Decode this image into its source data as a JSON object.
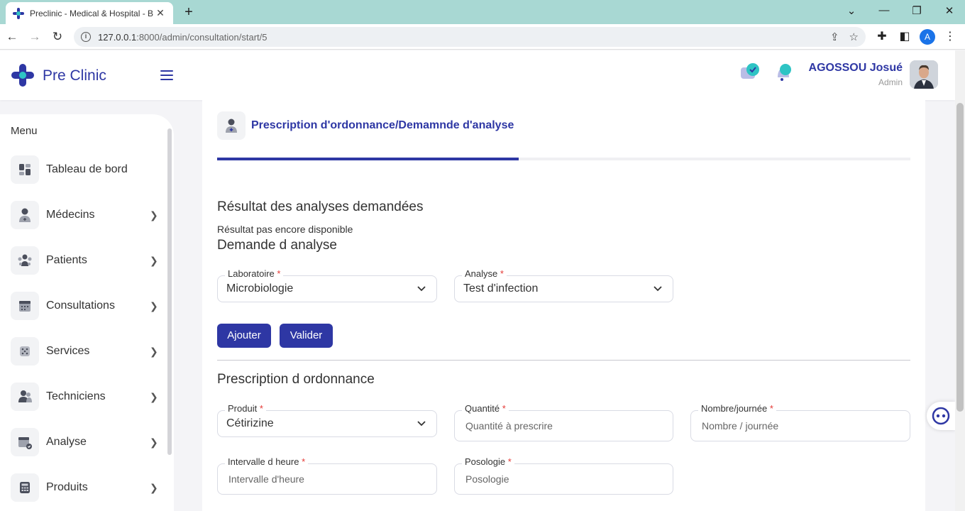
{
  "browser": {
    "tab_title": "Preclinic - Medical & Hospital - B",
    "url_host": "127.0.0.1",
    "url_path": ":8000/admin/consultation/start/5",
    "profile_initial": "A"
  },
  "header": {
    "brand": "Pre Clinic",
    "user_name": "AGOSSOU Josué",
    "user_role": "Admin"
  },
  "sidebar": {
    "menu_title": "Menu",
    "items": [
      {
        "label": "Tableau de bord",
        "icon": "dashboard-icon",
        "has_chevron": false
      },
      {
        "label": "Médecins",
        "icon": "doctor-icon",
        "has_chevron": true
      },
      {
        "label": "Patients",
        "icon": "patients-icon",
        "has_chevron": true
      },
      {
        "label": "Consultations",
        "icon": "calendar-icon",
        "has_chevron": true
      },
      {
        "label": "Services",
        "icon": "services-icon",
        "has_chevron": true
      },
      {
        "label": "Techniciens",
        "icon": "technicians-icon",
        "has_chevron": true
      },
      {
        "label": "Analyse",
        "icon": "analysis-calendar-icon",
        "has_chevron": true
      },
      {
        "label": "Produits",
        "icon": "calculator-icon",
        "has_chevron": true
      }
    ]
  },
  "main": {
    "card_title": "Prescription d'ordonnance/Demamnde d'analyse",
    "progress_percent": 43.5,
    "results_heading": "Résultat des analyses demandées",
    "results_text": "Résultat pas encore disponible",
    "request_heading": "Demande d analyse",
    "laboratoire": {
      "label": "Laboratoire",
      "value": "Microbiologie"
    },
    "analyse": {
      "label": "Analyse",
      "value": "Test d'infection"
    },
    "ajouter_label": "Ajouter",
    "valider_label": "Valider",
    "prescription_heading": "Prescription d ordonnance",
    "produit": {
      "label": "Produit",
      "value": "Cétirizine"
    },
    "quantite": {
      "label": "Quantité",
      "placeholder": "Quantité à prescrire"
    },
    "nombre": {
      "label": "Nombre/journée",
      "placeholder": "Nombre / journée"
    },
    "intervalle": {
      "label": "Intervalle d heure",
      "placeholder": "Intervalle d'heure"
    },
    "posologie": {
      "label": "Posologie",
      "placeholder": "Posologie"
    }
  },
  "colors": {
    "primary": "#2e37a4",
    "required": "#e53935",
    "accent_teal": "#2ec4c4"
  }
}
